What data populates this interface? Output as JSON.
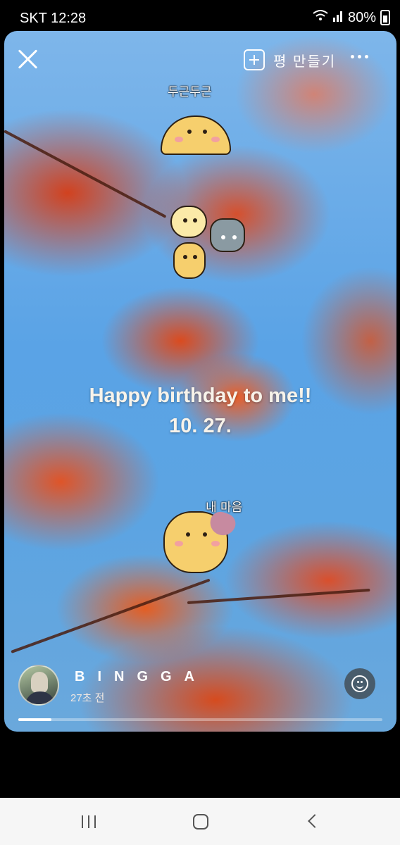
{
  "status_bar": {
    "carrier_time": "SKT 12:28",
    "battery": "80%"
  },
  "story": {
    "make_label": "평 만들기",
    "sticker_texts": {
      "top": "두근두근",
      "bottom": "내 마음"
    },
    "caption": {
      "line1": "Happy birthday to me!!",
      "line2": "10. 27."
    },
    "author": {
      "name": "BINGGA",
      "time": "27초 전"
    },
    "progress": 0.09
  },
  "icons": {
    "close": "close-icon",
    "add": "plus-square-icon",
    "more": "more-horizontal-icon",
    "emoji": "smile-icon"
  },
  "colors": {
    "sky": "#5aa3e6",
    "leaf": "#e2511e"
  }
}
